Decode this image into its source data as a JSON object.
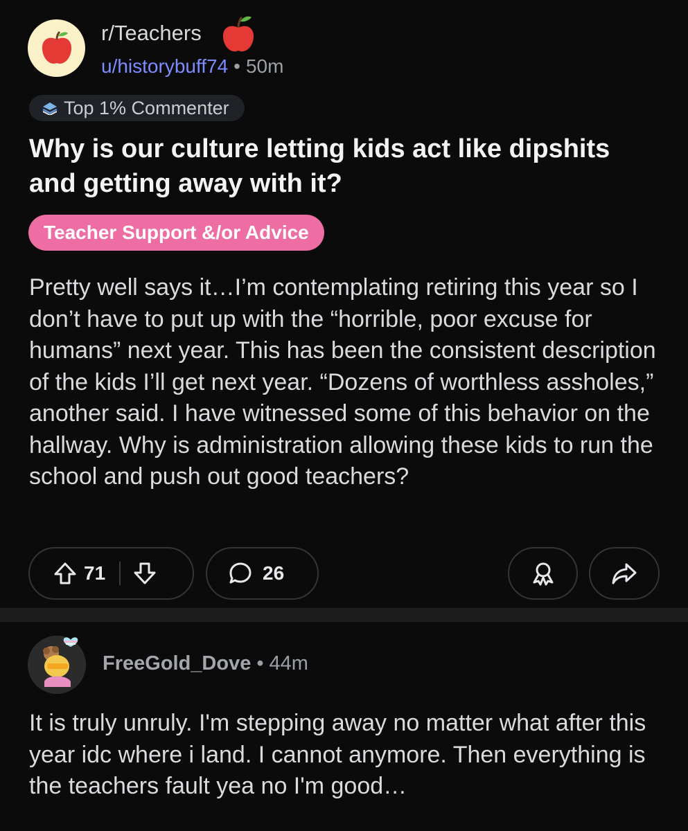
{
  "post": {
    "subreddit": "r/Teachers",
    "username": "u/historybuff74",
    "separator": "•",
    "age": "50m",
    "badge": "Top 1% Commenter",
    "title": "Why is our culture letting kids act like dipshits and getting away with it?",
    "flair": "Teacher Support &/or Advice",
    "body": "Pretty well says it…I’m contemplating retiring this year so I don’t have to put up with the “horrible, poor excuse for humans” next year.  This has been the consistent description of the kids I’ll get next year.  “Dozens of worthless assholes,” another said. I have witnessed some of this behavior on the hallway.  Why is administration allowing these kids to run the school and push out good teachers?",
    "votes": "71",
    "comments": "26"
  },
  "comment": {
    "username": "FreeGold_Dove",
    "separator": "•",
    "age": "44m",
    "body": "It is truly unruly. I'm stepping away no matter what after this year idc where i land. I cannot anymore. Then everything is the teachers fault yea no I'm good…"
  },
  "icons": {
    "subreddit_avatar": "apple-icon",
    "badge": "commenter-badge-icon",
    "upvote": "upvote-arrow-icon",
    "downvote": "downvote-arrow-icon",
    "comment": "speech-bubble-icon",
    "award": "award-ribbon-icon",
    "share": "share-arrow-icon"
  },
  "colors": {
    "background": "#0b0b0b",
    "username": "#7d8cff",
    "flair": "#ee6ea3",
    "subreddit_avatar_bg": "#fbf1c9",
    "apple": "#e53935"
  }
}
